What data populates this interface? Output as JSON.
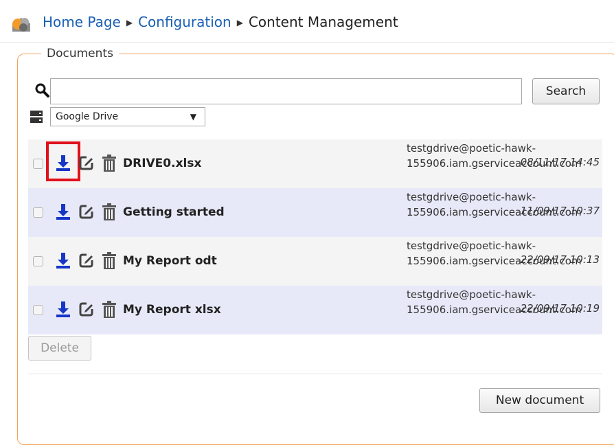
{
  "breadcrumb": {
    "items": [
      {
        "label": "Home Page"
      },
      {
        "label": "Configuration"
      }
    ],
    "current": "Content Management",
    "separator": "▶"
  },
  "documents_panel": {
    "legend": "Documents",
    "search": {
      "value": "",
      "button_label": "Search"
    },
    "storage_select": {
      "selected": "Google Drive"
    },
    "rows": [
      {
        "name": "DRIVE0.xlsx",
        "owner": "testgdrive@poetic-hawk-155906.iam.gserviceaccount.com",
        "date": "08/11/17 14:45"
      },
      {
        "name": "Getting started",
        "owner": "testgdrive@poetic-hawk-155906.iam.gserviceaccount.com",
        "date": "11/09/17 10:37"
      },
      {
        "name": "My Report odt",
        "owner": "testgdrive@poetic-hawk-155906.iam.gserviceaccount.com",
        "date": "22/09/17 10:13"
      },
      {
        "name": "My Report xlsx",
        "owner": "testgdrive@poetic-hawk-155906.iam.gserviceaccount.com",
        "date": "22/09/17 10:19"
      }
    ],
    "delete_label": "Delete",
    "new_document_label": "New document"
  },
  "colors": {
    "link": "#1a5fb4",
    "download_icon": "#1636c8",
    "highlight": "#e0101a",
    "row_alt": "#e8e9f8",
    "fieldset_border": "#f0a35a"
  }
}
